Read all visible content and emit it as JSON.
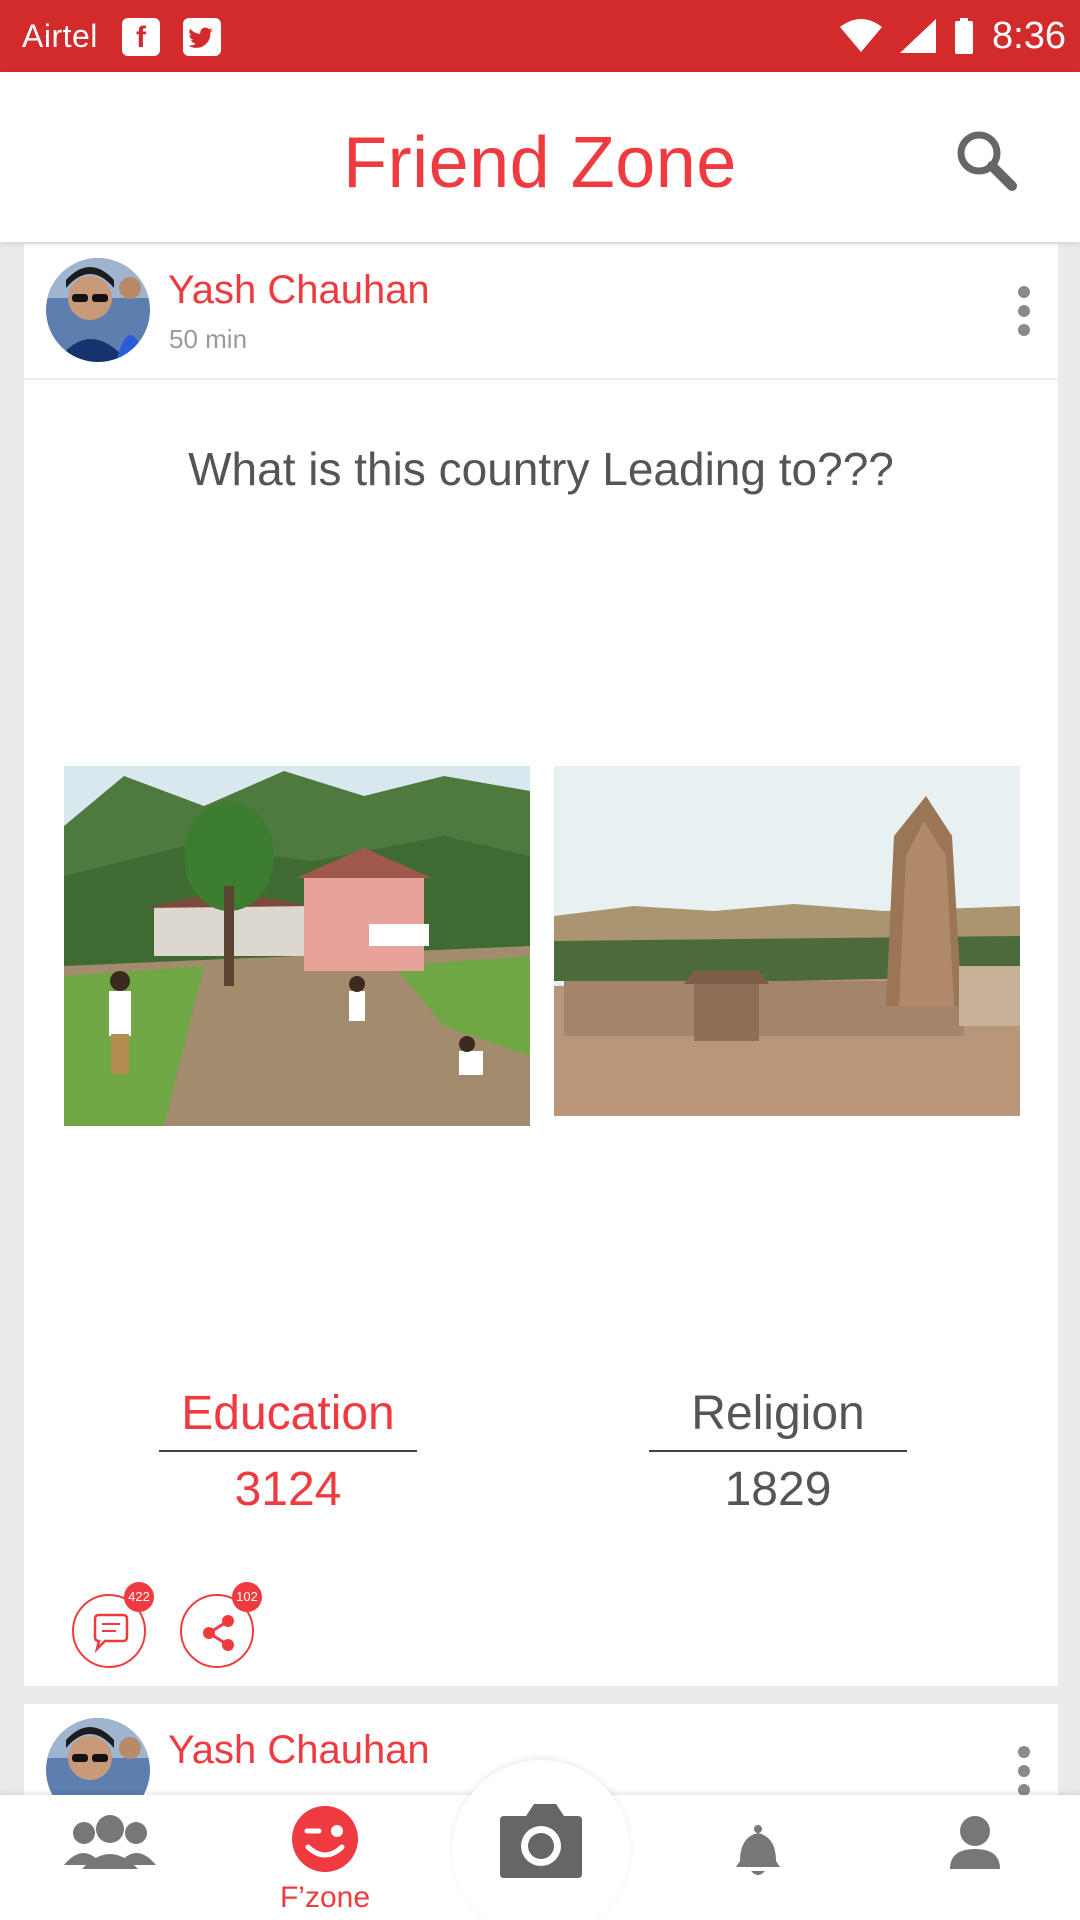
{
  "status_bar": {
    "carrier": "Airtel",
    "time": "8:36",
    "color": "#d32a2b"
  },
  "app_bar": {
    "title": "Friend Zone"
  },
  "posts": [
    {
      "author": "Yash Chauhan",
      "time": "50 min",
      "question": "What is this country Leading to???",
      "options": [
        {
          "label": "Education",
          "count": "3124"
        },
        {
          "label": "Religion",
          "count": "1829"
        }
      ],
      "comments_count": "422",
      "shares_count": "102"
    },
    {
      "author": "Yash Chauhan"
    }
  ],
  "bottom_nav": {
    "items": [
      {
        "icon": "friends-icon"
      },
      {
        "icon": "wink-face-icon",
        "label": "F’zone"
      },
      {
        "icon": "camera-icon"
      },
      {
        "icon": "bell-icon"
      },
      {
        "icon": "profile-icon"
      }
    ]
  },
  "colors": {
    "accent": "#ef3b3f",
    "muted_text": "#555555"
  }
}
